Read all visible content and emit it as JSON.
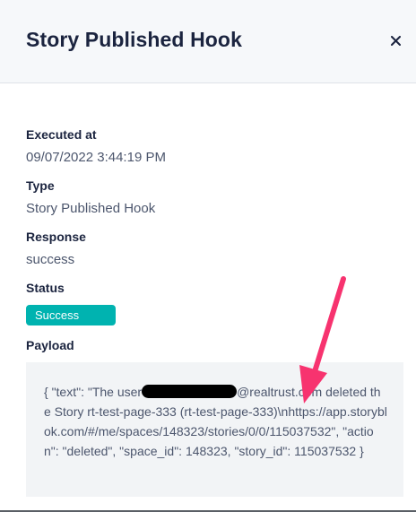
{
  "dialog": {
    "title": "Story Published Hook",
    "close_symbol": "×"
  },
  "fields": {
    "executed_at": {
      "label": "Executed at",
      "value": "09/07/2022 3:44:19 PM"
    },
    "type": {
      "label": "Type",
      "value": "Story Published Hook"
    },
    "response": {
      "label": "Response",
      "value": "success"
    },
    "status": {
      "label": "Status",
      "value": "Success"
    },
    "payload": {
      "label": "Payload",
      "text_before": "{ \"text\": \"The user",
      "text_after": "@realtrust.com deleted the Story rt-test-page-333 (rt-test-page-333)\\nhttps://app.storyblok.com/#/me/spaces/148323/stories/0/0/115037532\", \"action\": \"deleted\", \"space_id\": 148323, \"story_id\": 115037532 }"
    }
  },
  "colors": {
    "status_badge": "#00b3b0",
    "annotation_arrow": "#f7336f",
    "header_bg": "#f6f8fa",
    "payload_bg": "#f2f4f6"
  },
  "icons": {
    "close": "close-icon",
    "annotation": "arrow-annotation"
  }
}
